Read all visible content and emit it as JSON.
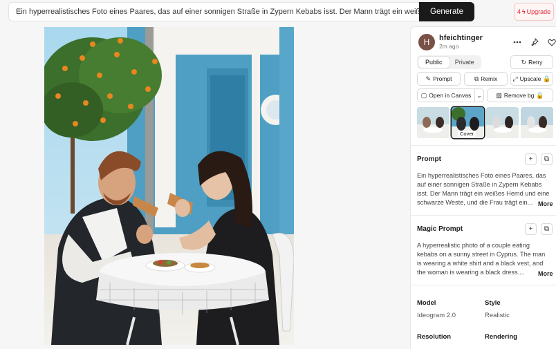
{
  "search": {
    "value": "Ein hyperrealistisches Foto eines Paares, das auf einer sonnigen Straße in Zypern Kebabs isst. Der Mann trägt ein weißes Hemd und eine",
    "generate_label": "Generate"
  },
  "upgrade": {
    "count": "4",
    "label": "Upgrade"
  },
  "user": {
    "initial": "H",
    "name": "hfeichtinger",
    "time": "2m ago"
  },
  "visibility": {
    "public": "Public",
    "private": "Private",
    "selected": "Public"
  },
  "actions": {
    "retry": "Retry",
    "prompt": "Prompt",
    "remix": "Remix",
    "upscale": "Upscale",
    "open_in_canvas": "Open in Canvas",
    "remove_bg": "Remove bg"
  },
  "thumbnails": {
    "cover_label": "Cover",
    "selected_index": 1
  },
  "prompt_section": {
    "title": "Prompt",
    "line1": "Ein hyperrealistisches Foto eines Paares, das",
    "line2": "auf einer sonnigen Straße in Zypern Kebabs",
    "line3": "isst. Der Mann trägt ein weißes Hemd und eine",
    "line4": "schwarze Weste, und die Frau trägt ein...",
    "more": "More"
  },
  "magic_prompt_section": {
    "title": "Magic Prompt",
    "line1": "A hyperrealistic photo of a couple eating",
    "line2": "kebabs on a sunny street in Cyprus. The man",
    "line3": "is wearing a white shirt and a black vest, and",
    "line4": "the woman is wearing a black dress....",
    "more": "More"
  },
  "meta": {
    "model_label": "Model",
    "model_value": "Ideogram 2.0",
    "style_label": "Style",
    "style_value": "Realistic",
    "resolution_label": "Resolution",
    "rendering_label": "Rendering"
  },
  "colors": {
    "accent": "#1a1a1a",
    "upgrade": "#e0283a",
    "wall": "#4f9fc4"
  }
}
